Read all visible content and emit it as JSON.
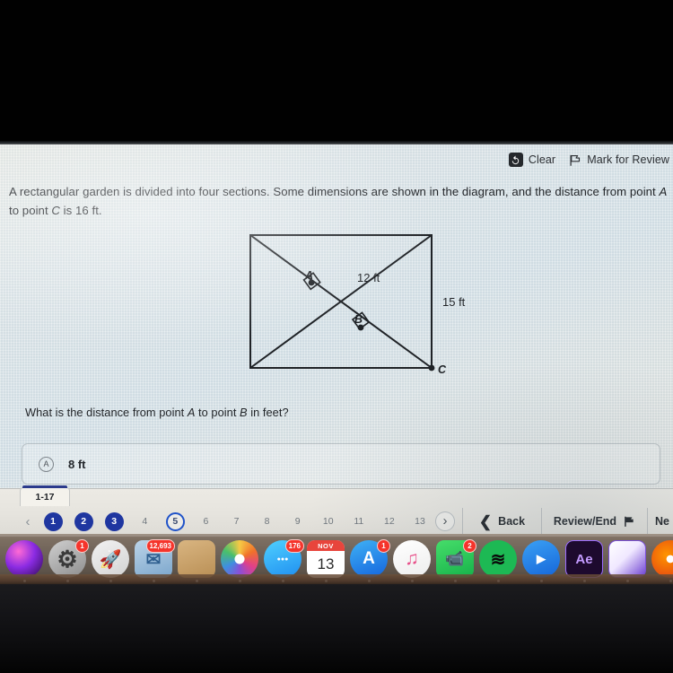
{
  "toolbar": {
    "clear_label": "Clear",
    "clear_icon": "undo-circular-arrow-icon",
    "mark_label": "Mark for Review",
    "mark_icon": "flag-icon"
  },
  "question": {
    "stem_part1": "A rectangular garden is divided into four sections. Some dimensions are shown in the diagram, and the distance from point ",
    "stem_a": "A",
    "stem_mid": " to point ",
    "stem_c": "C",
    "stem_end": " is 16 ft.",
    "prompt_part1": "What is the distance from point ",
    "prompt_a": "A",
    "prompt_mid": " to point ",
    "prompt_b": "B",
    "prompt_end": " in feet?"
  },
  "diagram": {
    "point_a": "A",
    "point_b": "B",
    "point_c": "C",
    "dim_diagonal": "12 ft",
    "dim_right_side": "15 ft"
  },
  "options": [
    {
      "letter": "A",
      "text": "8 ft"
    }
  ],
  "nav": {
    "tab_label": "1-17",
    "prev_arrow": "‹",
    "next_arrow": "›",
    "pages": [
      {
        "num": "1",
        "state": "answered"
      },
      {
        "num": "2",
        "state": "answered"
      },
      {
        "num": "3",
        "state": "answered"
      },
      {
        "num": "4",
        "state": "plain"
      },
      {
        "num": "5",
        "state": "current"
      },
      {
        "num": "6",
        "state": "plain"
      },
      {
        "num": "7",
        "state": "plain"
      },
      {
        "num": "8",
        "state": "plain"
      },
      {
        "num": "9",
        "state": "plain"
      },
      {
        "num": "10",
        "state": "plain"
      },
      {
        "num": "11",
        "state": "plain"
      },
      {
        "num": "12",
        "state": "plain"
      },
      {
        "num": "13",
        "state": "plain"
      }
    ],
    "back_label": "Back",
    "review_label": "Review/End",
    "next_label": "Ne"
  },
  "dock": {
    "items": [
      {
        "name": "siri-icon",
        "label": "",
        "badge": ""
      },
      {
        "name": "system-preferences-icon",
        "label": "",
        "badge": "1"
      },
      {
        "name": "launchpad-icon",
        "label": "",
        "badge": ""
      },
      {
        "name": "mail-icon",
        "label": "",
        "badge": "12,693"
      },
      {
        "name": "notes-icon",
        "label": "",
        "badge": ""
      },
      {
        "name": "photos-icon",
        "label": "",
        "badge": ""
      },
      {
        "name": "messages-icon",
        "label": "",
        "badge": "176"
      },
      {
        "name": "calendar-icon",
        "label": "13",
        "badge": "",
        "month": "NOV"
      },
      {
        "name": "app-store-icon",
        "label": "",
        "badge": "1"
      },
      {
        "name": "itunes-icon",
        "label": "",
        "badge": ""
      },
      {
        "name": "facetime-icon",
        "label": "",
        "badge": "2"
      },
      {
        "name": "spotify-icon",
        "label": "",
        "badge": ""
      },
      {
        "name": "zoom-icon",
        "label": "",
        "badge": ""
      },
      {
        "name": "after-effects-icon",
        "label": "Ae",
        "badge": ""
      },
      {
        "name": "premiere-rush-icon",
        "label": "",
        "badge": ""
      },
      {
        "name": "firefox-icon",
        "label": "",
        "badge": ""
      },
      {
        "name": "chrome-icon",
        "label": "",
        "badge": ""
      }
    ]
  },
  "colors": {
    "accent_blue": "#1f36a0",
    "current_blue": "#1f52c8",
    "badge_red": "#f5342b",
    "screen_bg": "#dfe6e8",
    "text": "#23262a"
  }
}
